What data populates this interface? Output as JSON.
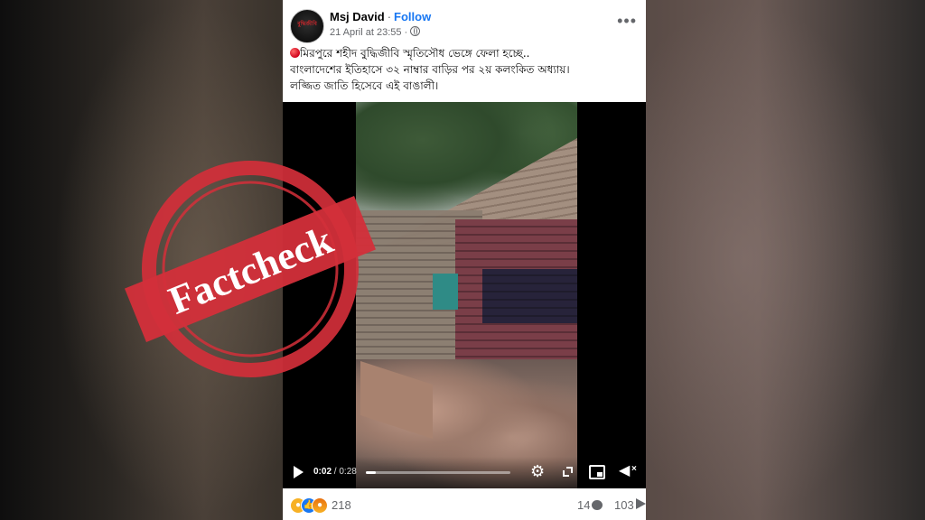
{
  "post": {
    "author": "Msj David",
    "separator": "·",
    "follow_label": "Follow",
    "date": "21 April at 23:55 ·",
    "more": "•••",
    "text_lines": [
      "মিরপুরে শহীদ বুদ্ধিজীবি স্মৃতিসৌধ ভেঙ্গে ফেলা হচ্ছে..",
      "বাংলাদেশের ইতিহাসে ৩২ নাম্বার বাড়ির পর ২য় কলংকিত অধ্যায়।",
      "লজ্জিত জাতি হিসেবে এই বাঙালী।"
    ]
  },
  "avatar": {
    "text": "বুদ্ধিজীবি"
  },
  "video": {
    "current_time": "0:02",
    "duration": "/ 0:28",
    "progress": 0.07
  },
  "engagement": {
    "reactions_count": "218",
    "comments_count": "14",
    "shares_count": "103"
  },
  "stamp": {
    "text": "Factcheck",
    "color": "#d32f3a"
  },
  "colors": {
    "accent": "#1877f2",
    "muted": "#65676b",
    "stamp": "#d32f3a"
  },
  "icons": [
    "globe-icon",
    "more-icon",
    "play-icon",
    "gear-icon",
    "fullscreen-icon",
    "pip-icon",
    "volume-off-icon",
    "sad-reaction-icon",
    "like-reaction-icon",
    "angry-reaction-icon",
    "comment-icon",
    "share-icon"
  ]
}
